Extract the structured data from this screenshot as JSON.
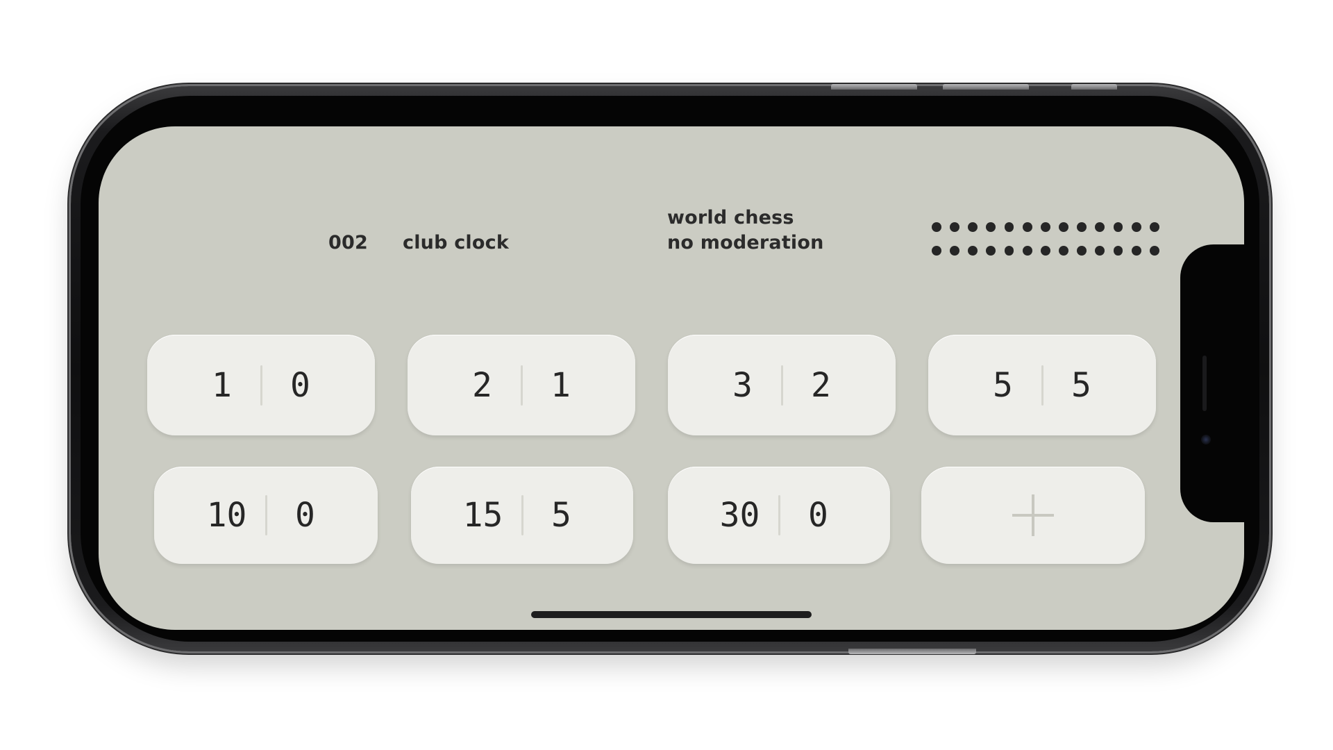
{
  "header": {
    "id_label": "002",
    "mode_label": "club clock",
    "rule_line1": "world chess",
    "rule_line2": "no moderation"
  },
  "decor": {
    "dot_rows": 2,
    "dots_per_row": 13
  },
  "presets": [
    {
      "minutes": "1",
      "increment": "0"
    },
    {
      "minutes": "2",
      "increment": "1"
    },
    {
      "minutes": "3",
      "increment": "2"
    },
    {
      "minutes": "5",
      "increment": "5"
    },
    {
      "minutes": "10",
      "increment": "0"
    },
    {
      "minutes": "15",
      "increment": "5"
    },
    {
      "minutes": "30",
      "increment": "0"
    }
  ],
  "add_preset": {
    "icon": "plus-icon"
  },
  "colors": {
    "screen_background": "#cbccc3",
    "tile_background": "#eeeeea",
    "text": "#262626"
  }
}
